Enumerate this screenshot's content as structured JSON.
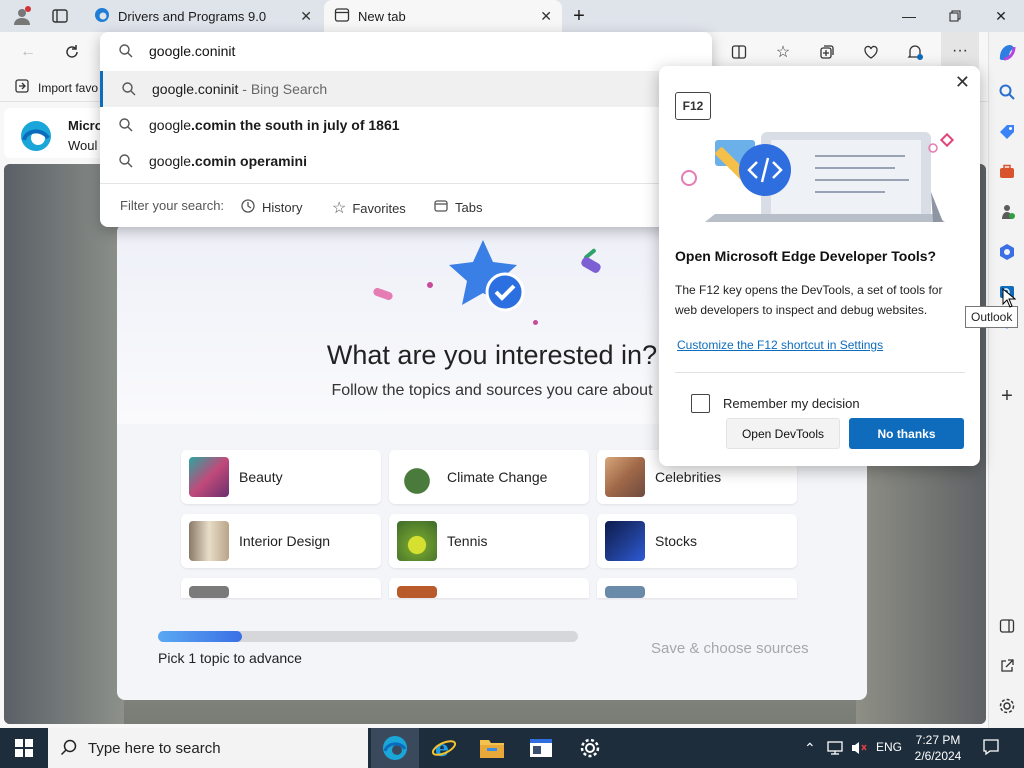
{
  "tabs": [
    {
      "title": "Drivers and Programs 9.0",
      "active": false
    },
    {
      "title": "New tab",
      "active": true
    }
  ],
  "address": {
    "value": "google.coninit"
  },
  "suggestions": [
    {
      "prefix": "google.coninit",
      "suffix": " - Bing Search",
      "selected": true
    },
    {
      "prefix": "google",
      "bold": ".comin the south in july of 1861",
      "selected": false
    },
    {
      "prefix": "google",
      "bold": ".comin operamini",
      "selected": false
    }
  ],
  "filter": {
    "label": "Filter your search:",
    "history": "History",
    "favorites": "Favorites",
    "tabs": "Tabs"
  },
  "favorites_bar": {
    "import": "Import favo"
  },
  "infobar": {
    "line1": "Micro",
    "line2": "Woul"
  },
  "devtools_popup": {
    "key": "F12",
    "title": "Open Microsoft Edge Developer Tools?",
    "description": "The F12 key opens the DevTools, a set of tools for web developers to inspect and debug websites.",
    "link": "Customize the F12 shortcut in Settings",
    "checkbox_label": "Remember my decision",
    "open_button": "Open DevTools",
    "no_button": "No thanks",
    "close": "✕"
  },
  "tooltip": "Outlook",
  "interests": {
    "title": "What are you interested in?",
    "subtitle": "Follow the topics and sources you care about",
    "topics": [
      {
        "label": "Beauty",
        "color": "#c04a7a"
      },
      {
        "label": "Climate Change",
        "color": "#4a7b3d"
      },
      {
        "label": "Celebrities",
        "color": "#a06848"
      },
      {
        "label": "Interior Design",
        "color": "#b9a488"
      },
      {
        "label": "Tennis",
        "color": "#6c9a2e"
      },
      {
        "label": "Stocks",
        "color": "#1e3a8a"
      }
    ],
    "progress_fraction": 0.2,
    "progress_label": "Pick 1 topic to advance",
    "save_label": "Save & choose sources"
  },
  "taskbar": {
    "search_placeholder": "Type here to search",
    "language": "ENG",
    "time": "7:27 PM",
    "date": "2/6/2024"
  },
  "colors": {
    "accent": "#0f6cbd",
    "taskbar": "#1d2d3b"
  }
}
